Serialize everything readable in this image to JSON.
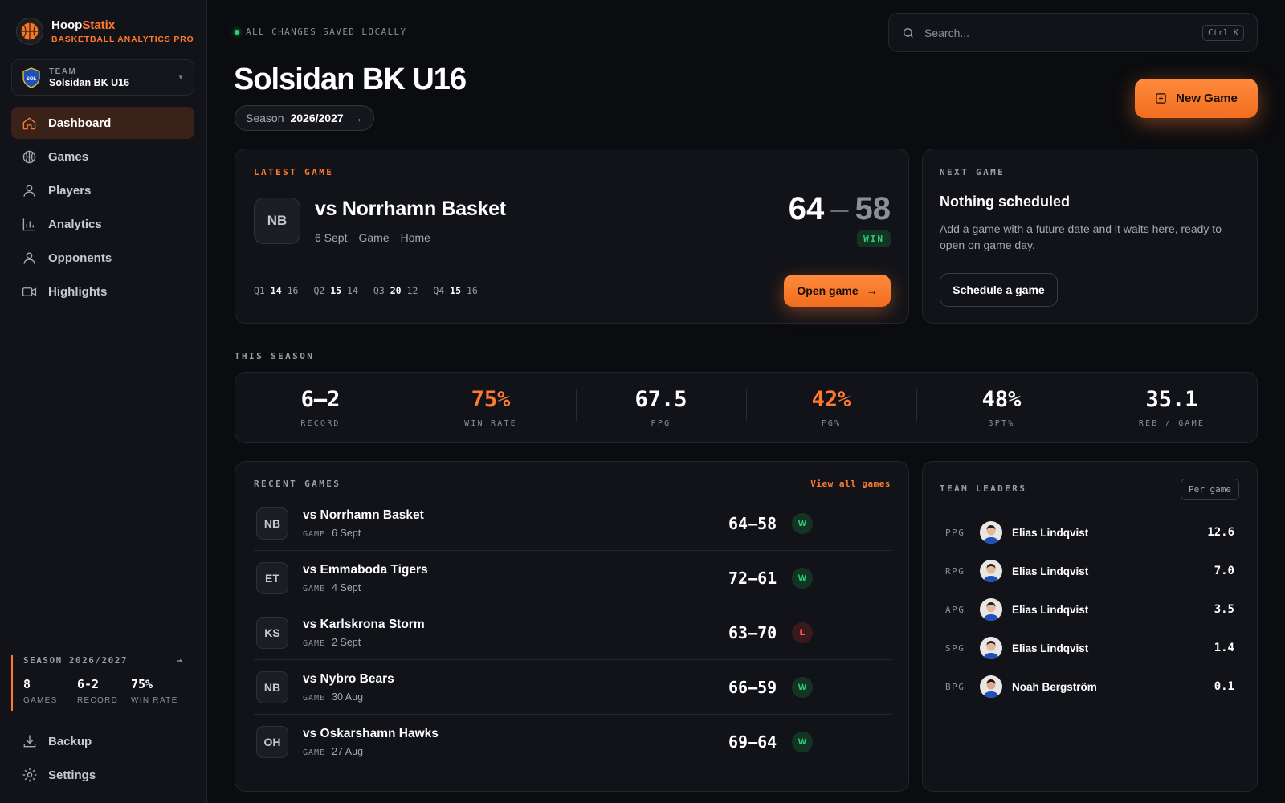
{
  "brand": {
    "name_a": "Hoop",
    "name_b": "Statix",
    "subtitle": "BASKETBALL ANALYTICS PRO"
  },
  "team": {
    "label": "TEAM",
    "name": "Solsidan BK U16",
    "badge_text": "SOL"
  },
  "nav": [
    {
      "label": "Dashboard",
      "icon": "home-icon",
      "active": true
    },
    {
      "label": "Games",
      "icon": "basketball-icon"
    },
    {
      "label": "Players",
      "icon": "user-icon"
    },
    {
      "label": "Analytics",
      "icon": "bar-chart-icon"
    },
    {
      "label": "Opponents",
      "icon": "user-icon"
    },
    {
      "label": "Highlights",
      "icon": "video-icon"
    }
  ],
  "sidebar_season": {
    "title": "SEASON 2026/2027",
    "stats": [
      {
        "value": "8",
        "label": "GAMES"
      },
      {
        "value": "6-2",
        "label": "RECORD"
      },
      {
        "value": "75%",
        "label": "WIN RATE"
      }
    ]
  },
  "bottom_nav": {
    "backup": "Backup",
    "settings": "Settings"
  },
  "status": "ALL CHANGES SAVED LOCALLY",
  "search": {
    "placeholder": "Search...",
    "shortcut": "Ctrl K"
  },
  "page": {
    "title": "Solsidan BK U16",
    "season_label": "Season",
    "season_value": "2026/2027"
  },
  "new_game_label": "New Game",
  "latest_game": {
    "eyebrow": "LATEST GAME",
    "initials": "NB",
    "title": "vs Norrhamn Basket",
    "date": "6 Sept",
    "type": "Game",
    "venue": "Home",
    "score_us": "64",
    "score_them": "58",
    "result": "WIN",
    "quarters": [
      {
        "q": "Q1",
        "us": "14",
        "them": "16"
      },
      {
        "q": "Q2",
        "us": "15",
        "them": "14"
      },
      {
        "q": "Q3",
        "us": "20",
        "them": "12"
      },
      {
        "q": "Q4",
        "us": "15",
        "them": "16"
      }
    ],
    "open_label": "Open game"
  },
  "next_game": {
    "eyebrow": "NEXT GAME",
    "title": "Nothing scheduled",
    "text": "Add a game with a future date and it waits here, ready to open on game day.",
    "button": "Schedule a game"
  },
  "this_season": {
    "label": "THIS SEASON",
    "stats": [
      {
        "value": "6–2",
        "label": "RECORD",
        "accent": false
      },
      {
        "value": "75%",
        "label": "WIN RATE",
        "accent": true
      },
      {
        "value": "67.5",
        "label": "PPG",
        "accent": false
      },
      {
        "value": "42%",
        "label": "FG%",
        "accent": true
      },
      {
        "value": "48%",
        "label": "3PT%",
        "accent": false
      },
      {
        "value": "35.1",
        "label": "REB / GAME",
        "accent": false
      }
    ]
  },
  "recent_games": {
    "label": "RECENT GAMES",
    "view_all": "View all games",
    "tag": "GAME",
    "rows": [
      {
        "initials": "NB",
        "name": "vs Norrhamn Basket",
        "date": "6 Sept",
        "score": "64–58",
        "result": "W"
      },
      {
        "initials": "ET",
        "name": "vs Emmaboda Tigers",
        "date": "4 Sept",
        "score": "72–61",
        "result": "W"
      },
      {
        "initials": "KS",
        "name": "vs Karlskrona Storm",
        "date": "2 Sept",
        "score": "63–70",
        "result": "L"
      },
      {
        "initials": "NB",
        "name": "vs Nybro Bears",
        "date": "30 Aug",
        "score": "66–59",
        "result": "W"
      },
      {
        "initials": "OH",
        "name": "vs Oskarshamn Hawks",
        "date": "27 Aug",
        "score": "69–64",
        "result": "W"
      }
    ]
  },
  "team_leaders": {
    "label": "TEAM LEADERS",
    "toggle": "Per game",
    "rows": [
      {
        "stat": "PPG",
        "name": "Elias Lindqvist",
        "value": "12.6"
      },
      {
        "stat": "RPG",
        "name": "Elias Lindqvist",
        "value": "7.0"
      },
      {
        "stat": "APG",
        "name": "Elias Lindqvist",
        "value": "3.5"
      },
      {
        "stat": "SPG",
        "name": "Elias Lindqvist",
        "value": "1.4"
      },
      {
        "stat": "BPG",
        "name": "Noah Bergström",
        "value": "0.1"
      }
    ]
  },
  "colors": {
    "accent": "#ff7a2f",
    "win": "#2dd17a",
    "loss": "#ff5a4f",
    "bg": "#0b0c0f",
    "card": "#121318"
  }
}
